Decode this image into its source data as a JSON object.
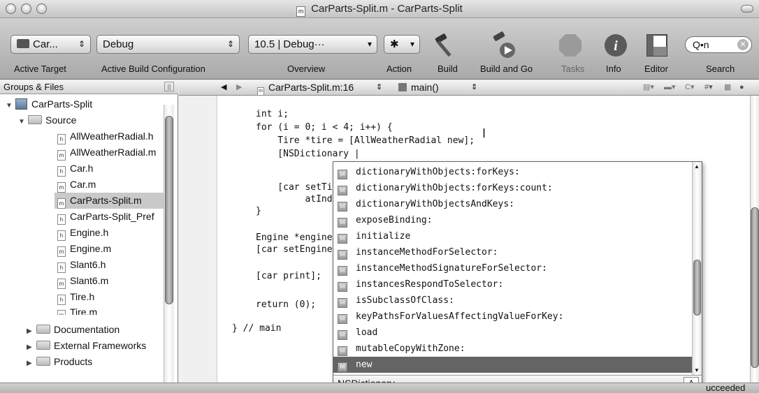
{
  "window": {
    "title": "CarParts-Split.m - CarParts-Split",
    "doc_icon": "m"
  },
  "toolbar": {
    "target_value": "Car...",
    "config_value": "Debug",
    "overview_value": "10.5 | Debug···",
    "action_glyph": "✱",
    "search_value": "Q•n",
    "captions": {
      "active_target": "Active Target",
      "active_build_config": "Active Build Configuration",
      "overview": "Overview",
      "action": "Action",
      "build": "Build",
      "build_and_go": "Build and Go",
      "tasks": "Tasks",
      "info": "Info",
      "editor": "Editor",
      "search": "Search"
    }
  },
  "sidebar": {
    "header": "Groups & Files",
    "items": [
      {
        "label": "CarParts-Split",
        "kind": "project"
      },
      {
        "label": "Source",
        "kind": "folder"
      },
      {
        "label": "AllWeatherRadial.h",
        "kind": "file"
      },
      {
        "label": "AllWeatherRadial.m",
        "kind": "file"
      },
      {
        "label": "Car.h",
        "kind": "file"
      },
      {
        "label": "Car.m",
        "kind": "file"
      },
      {
        "label": "CarParts-Split.m",
        "kind": "file"
      },
      {
        "label": "CarParts-Split_Pref",
        "kind": "file"
      },
      {
        "label": "Engine.h",
        "kind": "file"
      },
      {
        "label": "Engine.m",
        "kind": "file"
      },
      {
        "label": "Slant6.h",
        "kind": "file"
      },
      {
        "label": "Slant6.m",
        "kind": "file"
      },
      {
        "label": "Tire.h",
        "kind": "file"
      },
      {
        "label": "Tire.m",
        "kind": "file"
      },
      {
        "label": "Documentation",
        "kind": "folder"
      },
      {
        "label": "External Frameworks",
        "kind": "folder"
      },
      {
        "label": "Products",
        "kind": "folder"
      }
    ]
  },
  "editor": {
    "nav_file": "CarParts-Split.m:16",
    "nav_function": "main()",
    "code_lines": [
      "int i;",
      "for (i = 0; i < 4; i++) {",
      "    Tire *tire = [AllWeatherRadial new];",
      "    [NSDictionary |",
      "",
      "    [car setTi",
      "         atInd",
      "}",
      "",
      "Engine *engine",
      "[car setEngine",
      "",
      "[car print];",
      "",
      "return (0);",
      "",
      "} // main"
    ]
  },
  "completion": {
    "items": [
      "dictionaryWithObjects:forKeys:",
      "dictionaryWithObjects:forKeys:count:",
      "dictionaryWithObjectsAndKeys:",
      "exposeBinding:",
      "initialize",
      "instanceMethodForSelector:",
      "instanceMethodSignatureForSelector:",
      "instancesRespondToSelector:",
      "isSubclassOfClass:",
      "keyPathsForValuesAffectingValueForKey:",
      "load",
      "mutableCopyWithZone:",
      "new"
    ],
    "selected_index": 12,
    "footer_class": "NSDictionary",
    "footer_badge": "A"
  },
  "status": {
    "text": "ucceeded"
  }
}
